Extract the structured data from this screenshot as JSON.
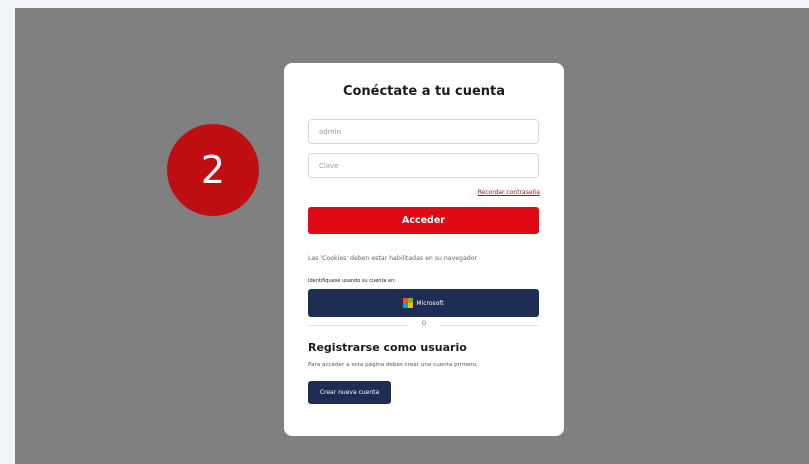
{
  "colors": {
    "accent_red": "#df0a14",
    "badge_red": "#c00f13",
    "navy": "#1f2c54",
    "overlay": "#808080"
  },
  "step_badge": {
    "number": "2"
  },
  "login": {
    "title": "Conéctate a tu cuenta",
    "username_value": "admin",
    "password_placeholder": "Clave",
    "forgot_link": "Recordar contraseña",
    "submit_label": "Acceder",
    "cookies_note": "Las 'Cookies' deben estar habilitadas en su navegador",
    "identify_label": "Identifíquese usando su cuenta en:",
    "microsoft_label": "Microsoft",
    "microsoft_icon": "microsoft-logo-icon",
    "divider_text": "O"
  },
  "register": {
    "title": "Registrarse como usuario",
    "description": "Para acceder a esta página debes crear una cuenta primero.",
    "button_label": "Crear nueva cuenta"
  }
}
